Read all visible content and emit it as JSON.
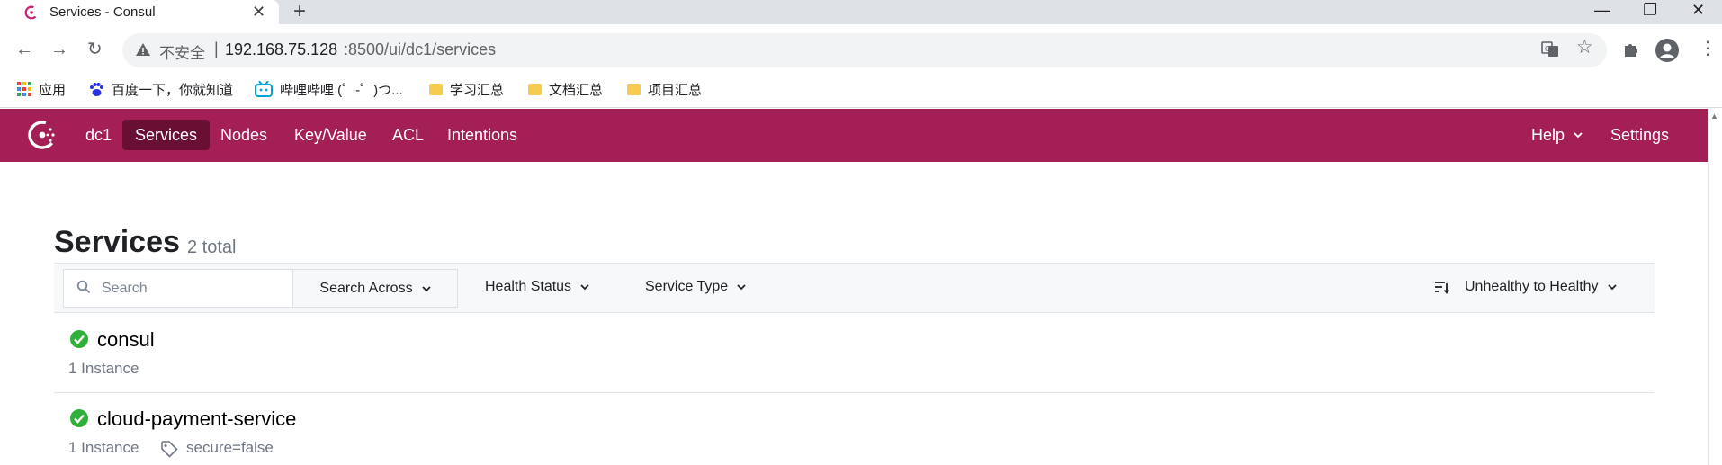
{
  "browser": {
    "tab_title": "Services - Consul",
    "close_symbol": "✕",
    "new_tab_symbol": "+",
    "window_controls": {
      "minimize": "—",
      "restore": "❐",
      "close": "✕"
    },
    "nav": {
      "back": "←",
      "forward": "→",
      "reload": "↻"
    },
    "security_label": "不安全",
    "url_host": "192.168.75.128",
    "url_path": ":8500/ui/dc1/services",
    "icons": [
      "translate-icon",
      "star-icon",
      "puzzle-icon",
      "profile-icon",
      "menu-icon"
    ],
    "menu_symbol": "⋮",
    "star_symbol": "☆",
    "bookmarks": [
      {
        "label": "应用",
        "icon": "apps-grid-icon"
      },
      {
        "label": "百度一下，你就知道",
        "icon": "baidu-paw-icon"
      },
      {
        "label": "哔哩哔哩 (゜-゜)つ...",
        "icon": "bilibili-tv-icon"
      },
      {
        "label": "学习汇总",
        "icon": "folder-icon"
      },
      {
        "label": "文档汇总",
        "icon": "folder-icon"
      },
      {
        "label": "项目汇总",
        "icon": "folder-icon"
      }
    ]
  },
  "app": {
    "brand_color": "#a31f55",
    "active_color": "#6a0f34",
    "datacenter": "dc1",
    "nav_items": [
      "Services",
      "Nodes",
      "Key/Value",
      "ACL",
      "Intentions"
    ],
    "active_nav": "Services",
    "help_label": "Help",
    "settings_label": "Settings"
  },
  "page": {
    "title": "Services",
    "count": "2 total"
  },
  "filters": {
    "search_placeholder": "Search",
    "search_across": "Search Across",
    "health_status": "Health Status",
    "service_type": "Service Type",
    "sort": "Unhealthy to Healthy"
  },
  "services": [
    {
      "name": "consul",
      "instances": "1 Instance",
      "tag": "",
      "health": "passing"
    },
    {
      "name": "cloud-payment-service",
      "instances": "1 Instance",
      "tag": "secure=false",
      "health": "passing"
    }
  ]
}
